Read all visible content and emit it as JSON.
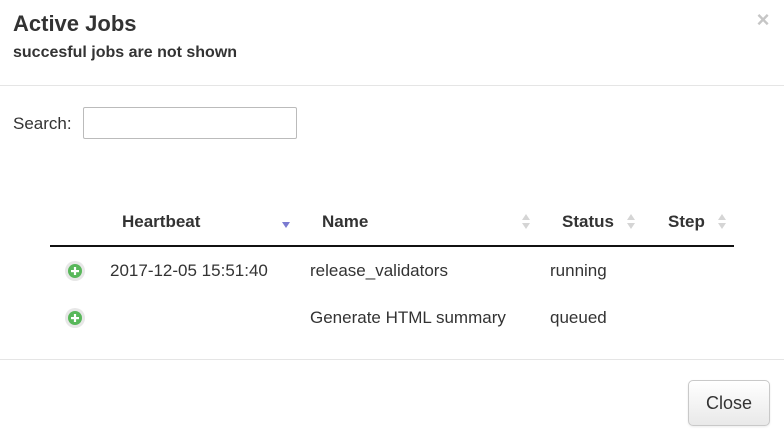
{
  "modal": {
    "title": "Active Jobs",
    "subtitle": "succesful jobs are not shown",
    "close_glyph": "×"
  },
  "search": {
    "label": "Search:",
    "value": "",
    "placeholder": ""
  },
  "table": {
    "columns": [
      {
        "label": "Heartbeat",
        "sort": "descending"
      },
      {
        "label": "Name",
        "sort": "none"
      },
      {
        "label": "Status",
        "sort": "none"
      },
      {
        "label": "Step",
        "sort": "none"
      }
    ],
    "rows": [
      {
        "expand_icon": "plus-circle-icon",
        "heartbeat": "2017-12-05 15:51:40",
        "name": "release_validators",
        "status": "running",
        "step": ""
      },
      {
        "expand_icon": "plus-circle-icon",
        "heartbeat": "",
        "name": "Generate HTML summary",
        "status": "queued",
        "step": ""
      }
    ]
  },
  "footer": {
    "close_label": "Close"
  },
  "colors": {
    "sort_active": "#7b7bd1",
    "sort_inactive": "#d5d5d5",
    "expand_green": "#58b75a"
  }
}
